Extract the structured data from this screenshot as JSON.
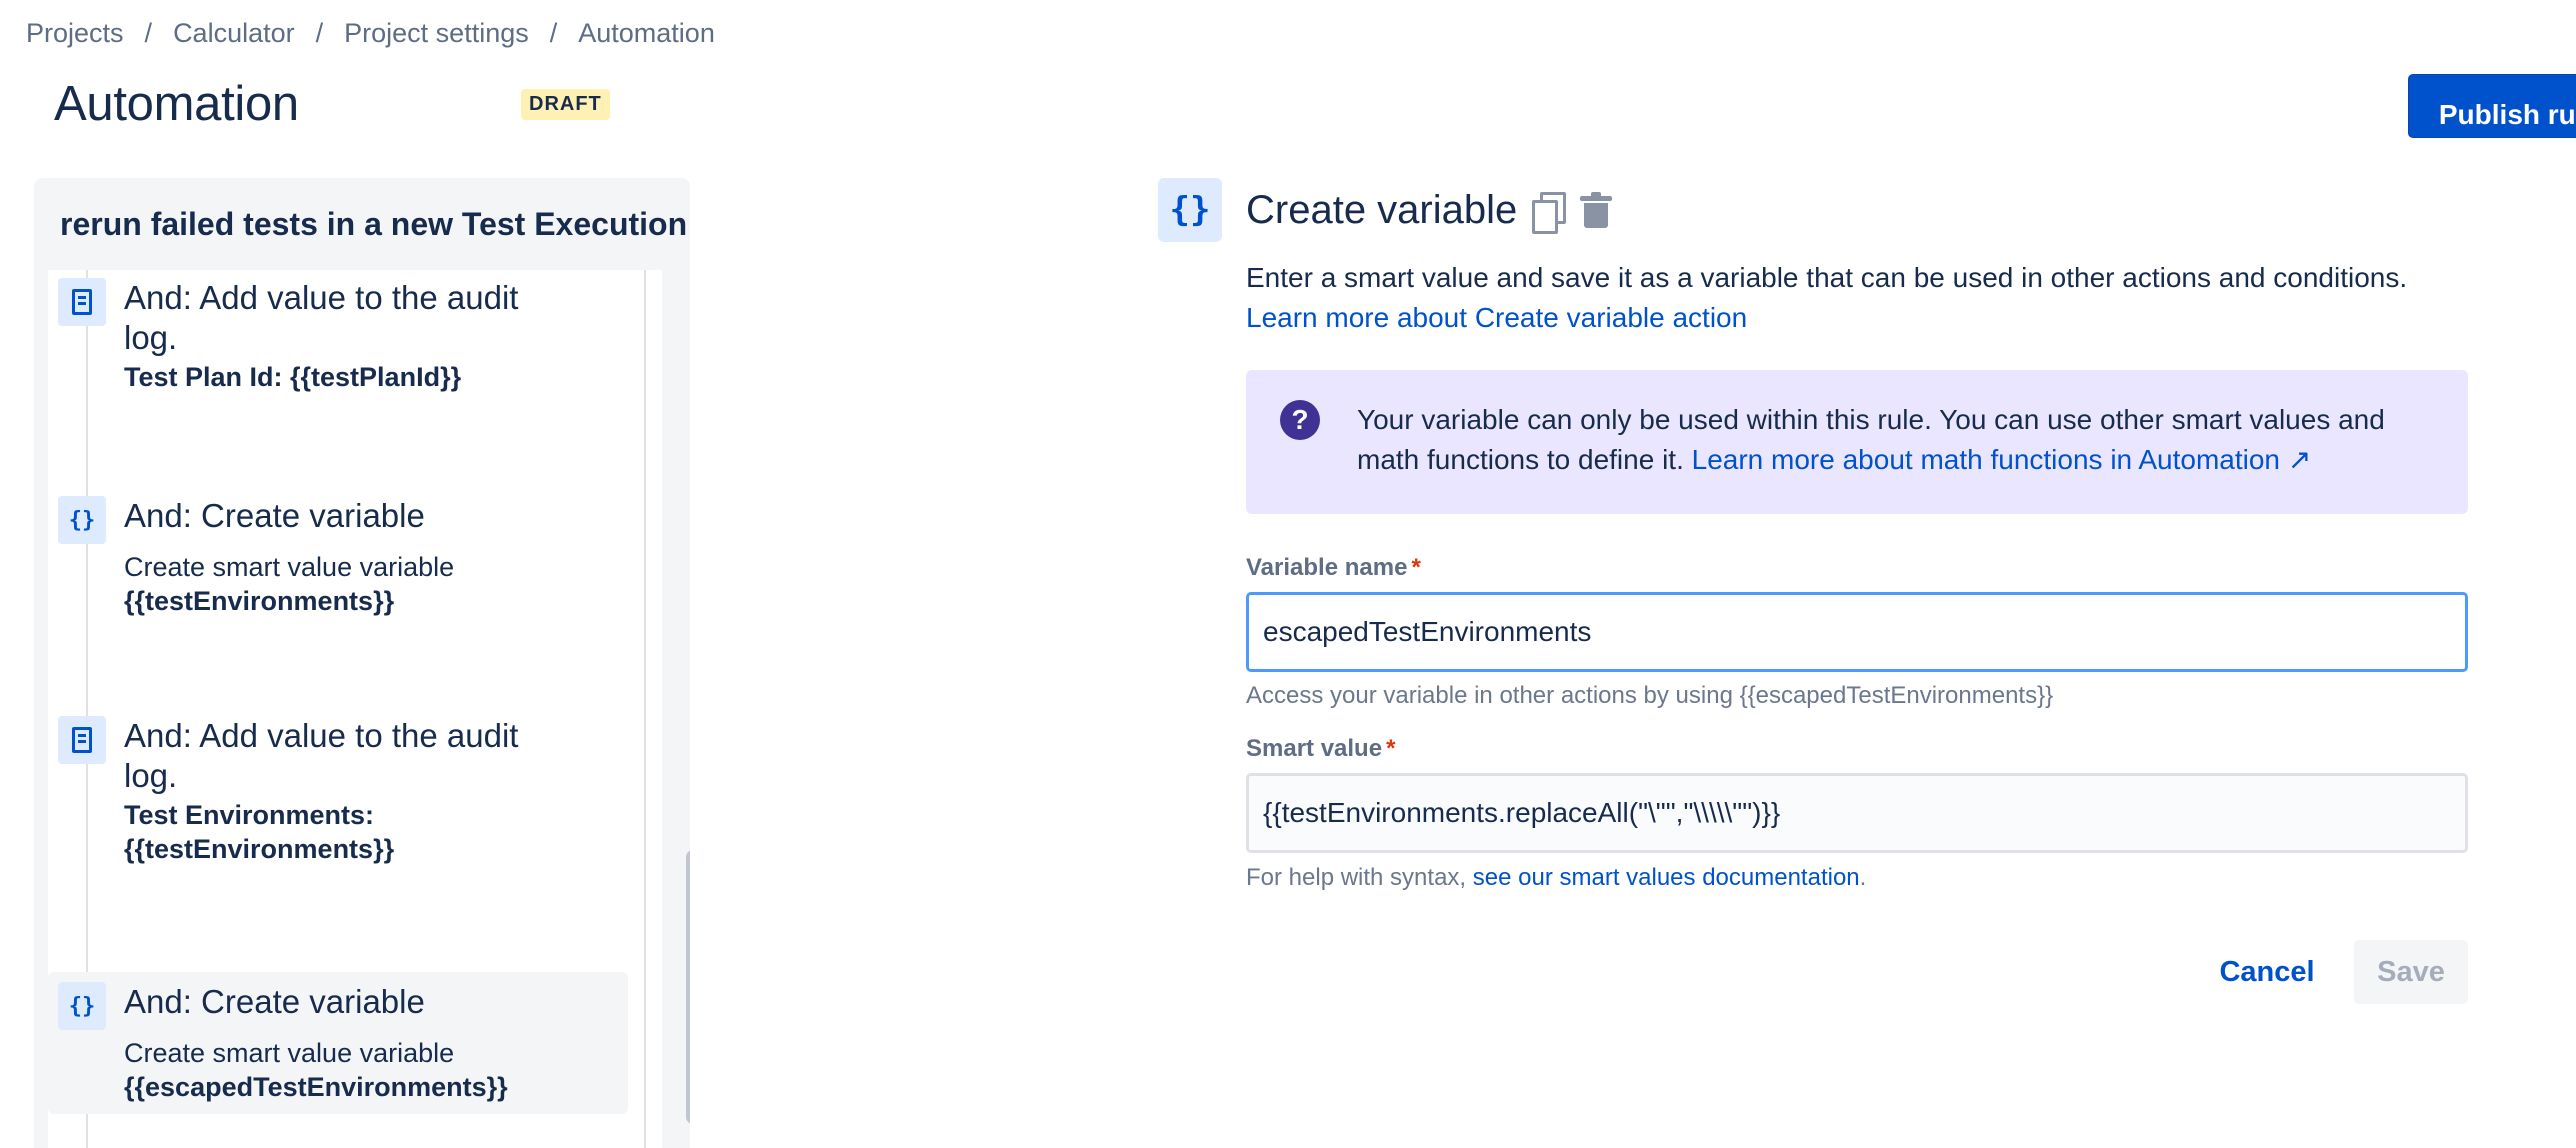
{
  "breadcrumb": {
    "items": [
      "Projects",
      "Calculator",
      "Project settings",
      "Automation"
    ],
    "separator": "/"
  },
  "header": {
    "title": "Automation",
    "badge": "DRAFT",
    "publish_label": "Publish rule"
  },
  "rule": {
    "name": "rerun failed tests in a new Test Execution",
    "steps": [
      {
        "icon": "audit-log-icon",
        "title": "And: Add value to the audit log.",
        "desc_bold": "Test Plan Id: {{testPlanId}}"
      },
      {
        "icon": "braces-icon",
        "icon_glyph": "{}",
        "title": "And: Create variable",
        "desc": "Create smart value variable",
        "desc_bold": "{{testEnvironments}}"
      },
      {
        "icon": "audit-log-icon",
        "title": "And: Add value to the audit log.",
        "desc_bold": "Test Environments: {{testEnvironments}}"
      },
      {
        "icon": "braces-icon",
        "icon_glyph": "{}",
        "title": "And: Create variable",
        "desc": "Create smart value variable",
        "desc_bold": "{{escapedTestEnvironments}}",
        "selected": true
      }
    ]
  },
  "action": {
    "icon_glyph": "{}",
    "title": "Create variable",
    "description": "Enter a smart value and save it as a variable that can be used in other actions and conditions.",
    "learn_more": "Learn more about Create variable action",
    "info": {
      "icon_glyph": "?",
      "text": "Your variable can only be used within this rule. You can use other smart values and math functions to define it. ",
      "link": "Learn more about math functions in Automation ↗"
    },
    "variable_name": {
      "label": "Variable name",
      "required": "*",
      "value": "escapedTestEnvironments",
      "help": "Access your variable in other actions by using {{escapedTestEnvironments}}"
    },
    "smart_value": {
      "label": "Smart value",
      "required": "*",
      "value": "{{testEnvironments.replaceAll(\"\\\"\",\"\\\\\\\\\\\"\")}}",
      "help_prefix": "For help with syntax, ",
      "help_link": "see our smart values documentation",
      "help_suffix": "."
    },
    "cancel_label": "Cancel",
    "save_label": "Save"
  },
  "colors": {
    "primary": "#0052cc",
    "badge_bg": "#fff0b3",
    "info_bg": "#eae6ff",
    "info_icon": "#403294",
    "required": "#de350b",
    "focus_border": "#4c9aff"
  }
}
